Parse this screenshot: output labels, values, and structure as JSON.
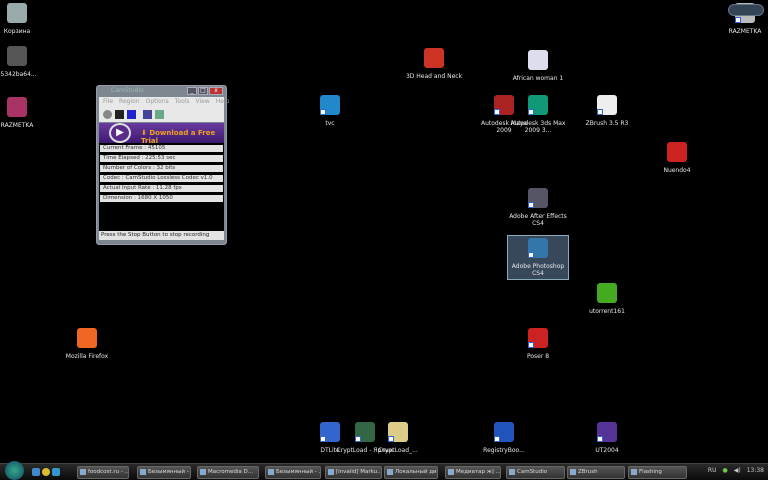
{
  "desktop_icons": [
    {
      "label": "Корзина",
      "icon": "recycle-bin-icon",
      "color": "#9aa"
    },
    {
      "label": "s5342ba64...",
      "icon": "file-icon",
      "color": "#555"
    },
    {
      "label": "RAZMETKA",
      "icon": "archive-icon",
      "color": "#a36"
    },
    {
      "label": "3D Head and Neck",
      "icon": "pdf-icon",
      "color": "#c32"
    },
    {
      "label": "African woman 1",
      "icon": "document-icon",
      "color": "#dde"
    },
    {
      "label": "tvc",
      "icon": "ie-icon",
      "color": "#28c"
    },
    {
      "label": "Autodesk Maya 2009",
      "icon": "maya-icon",
      "color": "#a22"
    },
    {
      "label": "Autodesk 3ds Max 2009 3...",
      "icon": "3dsmax-icon",
      "color": "#197"
    },
    {
      "label": "ZBrush 3.5 R3",
      "icon": "zbrush-icon",
      "color": "#eee"
    },
    {
      "label": "Nuendo4",
      "icon": "nuendo-icon",
      "color": "#c22"
    },
    {
      "label": "Adobe After Effects CS4",
      "icon": "after-effects-icon",
      "color": "#556"
    },
    {
      "label": "Adobe Photoshop CS4",
      "icon": "photoshop-icon",
      "color": "#37a"
    },
    {
      "label": "utorrent161",
      "icon": "utorrent-icon",
      "color": "#4a2"
    },
    {
      "label": "Mozilla Firefox",
      "icon": "firefox-icon",
      "color": "#e62"
    },
    {
      "label": "Poser 8",
      "icon": "poser-icon",
      "color": "#c22"
    },
    {
      "label": "DTLite",
      "icon": "daemon-tools-icon",
      "color": "#36c"
    },
    {
      "label": "CryptLoad - Ярлык",
      "icon": "cryptload-icon",
      "color": "#364"
    },
    {
      "label": "CryptLoad_...",
      "icon": "folder-icon",
      "color": "#dc8"
    },
    {
      "label": "RegistryBoo...",
      "icon": "registry-booster-icon",
      "color": "#25b"
    },
    {
      "label": "UT2004",
      "icon": "ut2004-icon",
      "color": "#539"
    },
    {
      "label": "RAZMETKA",
      "icon": "file-icon",
      "color": "#bbb"
    }
  ],
  "camstudio": {
    "title": "CamStudio",
    "menu": [
      "File",
      "Region",
      "Options",
      "Tools",
      "View",
      "Help"
    ],
    "banner": "Download a Free Trial",
    "fields": [
      "Current Frame : 45105",
      "Time Elapsed : 225:53 sec",
      "Number of Colors : 32 bits",
      "Codec : CamStudio Lossless Codec v1.0",
      "Actual Input Rate : 11.28 fps",
      "Dimension : 1680 X 1050"
    ],
    "status": "Press the Stop Button to stop recording"
  },
  "taskbar": {
    "buttons": [
      "foodcost.ru - ...",
      "Безымянный - ...",
      "Macromedia D...",
      "Безымянный - ...",
      "[invalid] Marku...",
      "Локальный ди...",
      "Медиатар ж] ...",
      "CamStudio",
      "ZBrush",
      "Flashing"
    ],
    "language": "RU",
    "clock": "13:38"
  }
}
